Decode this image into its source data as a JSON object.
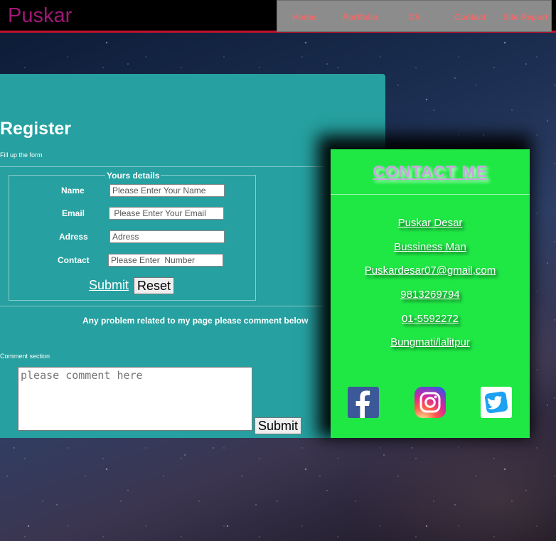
{
  "brand": "Puskar",
  "nav": [
    "Home",
    "Portfolio",
    "CV",
    "Contact",
    "Site Report"
  ],
  "register": {
    "title": "Register",
    "subtitle": "Fill up the form",
    "legend": "Yours details",
    "fields": [
      {
        "label": "Name",
        "placeholder": "Please Enter Your Name"
      },
      {
        "label": "Email",
        "placeholder": " Please Enter Your Email"
      },
      {
        "label": "Adress",
        "placeholder": "Adress"
      },
      {
        "label": "Contact",
        "placeholder": "Please Enter  Number"
      }
    ],
    "submit_label": "Submit",
    "reset_label": "Reset",
    "notice": "Any problem related to my page please comment below",
    "comment_label": "Comment section",
    "comment_placeholder": "please comment here",
    "comment_submit_label": "Submit"
  },
  "contact": {
    "title": "CONTACT ME",
    "items": [
      "Puskar Desar",
      "Bussiness Man",
      "Puskardesar07@gmail,com",
      "9813269794",
      "01-5592272",
      "Bungmati/lalitpur"
    ],
    "social": [
      "facebook-icon",
      "instagram-icon",
      "twitter-icon"
    ]
  },
  "colors": {
    "brand": "#a01876",
    "nav_link": "#f06a6a",
    "register_bg": "#26a0a0",
    "contact_bg": "#1fe845",
    "header_border": "#c4122e"
  }
}
